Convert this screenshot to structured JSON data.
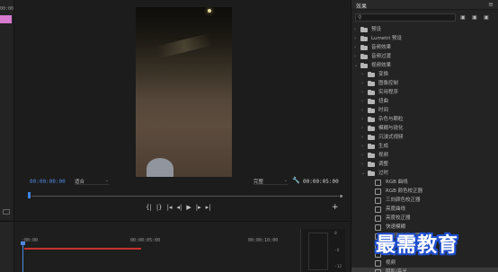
{
  "left_panel": {
    "timecode": "00:00"
  },
  "program_monitor": {
    "current_timecode": "00:00:00:00",
    "fit_select": "适合",
    "resolution_select": "完整",
    "duration_timecode": "00:00:05:00",
    "transport": {
      "mark_in": "{|",
      "mark_out": "|}",
      "go_to_in": "|◂",
      "step_back": "◂|",
      "play": "▶",
      "step_forward": "|▸",
      "go_to_out": "▸|"
    },
    "add_button": "+"
  },
  "effects_panel": {
    "title": "效果",
    "menu": "≡",
    "tree": [
      {
        "label": "预设",
        "level": 0,
        "expanded": false,
        "kind": "folder-star"
      },
      {
        "label": "Lumetri 预设",
        "level": 0,
        "expanded": false,
        "kind": "folder-star"
      },
      {
        "label": "音频效果",
        "level": 0,
        "expanded": false,
        "kind": "folder"
      },
      {
        "label": "音频过渡",
        "level": 0,
        "expanded": false,
        "kind": "folder"
      },
      {
        "label": "视频效果",
        "level": 0,
        "expanded": true,
        "kind": "folder"
      },
      {
        "label": "变换",
        "level": 1,
        "expanded": false,
        "kind": "folder"
      },
      {
        "label": "图像控制",
        "level": 1,
        "expanded": false,
        "kind": "folder"
      },
      {
        "label": "实用程序",
        "level": 1,
        "expanded": false,
        "kind": "folder"
      },
      {
        "label": "扭曲",
        "level": 1,
        "expanded": false,
        "kind": "folder"
      },
      {
        "label": "时间",
        "level": 1,
        "expanded": false,
        "kind": "folder"
      },
      {
        "label": "杂色与颗粒",
        "level": 1,
        "expanded": false,
        "kind": "folder"
      },
      {
        "label": "模糊与锐化",
        "level": 1,
        "expanded": false,
        "kind": "folder"
      },
      {
        "label": "沉浸式视频",
        "level": 1,
        "expanded": false,
        "kind": "folder"
      },
      {
        "label": "生成",
        "level": 1,
        "expanded": false,
        "kind": "folder"
      },
      {
        "label": "视频",
        "level": 1,
        "expanded": false,
        "kind": "folder"
      },
      {
        "label": "调整",
        "level": 1,
        "expanded": false,
        "kind": "folder"
      },
      {
        "label": "过时",
        "level": 1,
        "expanded": true,
        "kind": "folder"
      },
      {
        "label": "RGB 曲线",
        "level": 2,
        "kind": "effect"
      },
      {
        "label": "RGB 颜色校正器",
        "level": 2,
        "kind": "effect"
      },
      {
        "label": "三向颜色校正器",
        "level": 2,
        "kind": "effect"
      },
      {
        "label": "亮度曲线",
        "level": 2,
        "kind": "effect"
      },
      {
        "label": "亮度校正器",
        "level": 2,
        "kind": "effect"
      },
      {
        "label": "快速模糊",
        "level": 2,
        "kind": "effect"
      },
      {
        "label": "快速颜色校正器",
        "level": 2,
        "kind": "effect"
      },
      {
        "label": "自动",
        "level": 2,
        "kind": "effect"
      },
      {
        "label": "自动",
        "level": 2,
        "kind": "effect"
      },
      {
        "label": "视频",
        "level": 2,
        "kind": "effect"
      },
      {
        "label": "阴影/高光",
        "level": 2,
        "kind": "effect",
        "selected": true
      }
    ]
  },
  "timeline": {
    "ruler": [
      ":00:00",
      "00:00:05:00",
      "00:00:10:00"
    ],
    "meter_labels": [
      "0",
      "-6",
      "-12"
    ]
  },
  "watermark": "最需教育"
}
